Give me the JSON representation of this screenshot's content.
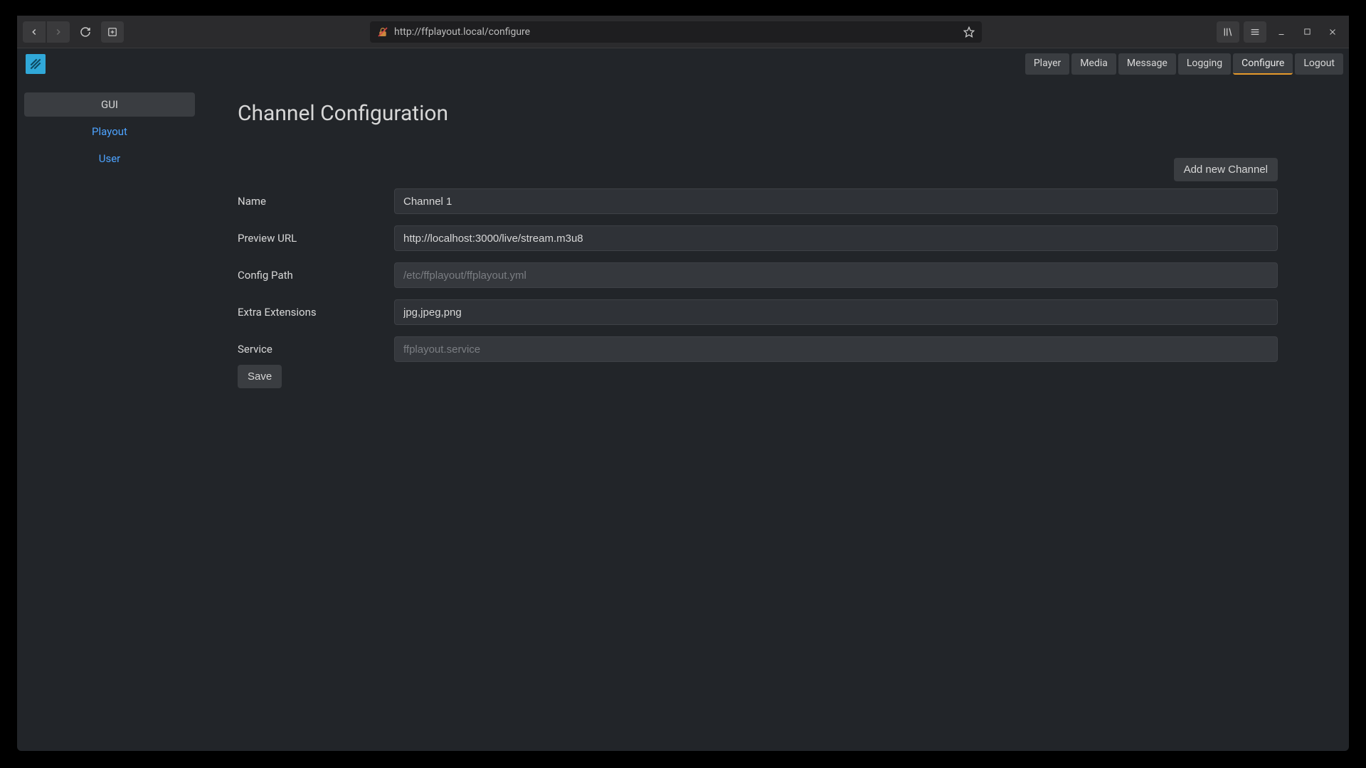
{
  "browser": {
    "url": "http://ffplayout.local/configure"
  },
  "nav": {
    "items": [
      {
        "label": "Player"
      },
      {
        "label": "Media"
      },
      {
        "label": "Message"
      },
      {
        "label": "Logging"
      },
      {
        "label": "Configure",
        "active": true
      },
      {
        "label": "Logout"
      }
    ]
  },
  "sidebar": {
    "items": [
      {
        "label": "GUI",
        "active": true
      },
      {
        "label": "Playout"
      },
      {
        "label": "User"
      }
    ]
  },
  "page": {
    "title": "Channel Configuration",
    "add_channel_label": "Add new Channel",
    "save_label": "Save"
  },
  "form": {
    "fields": [
      {
        "label": "Name",
        "value": "Channel 1",
        "disabled": false
      },
      {
        "label": "Preview URL",
        "value": "http://localhost:3000/live/stream.m3u8",
        "disabled": false
      },
      {
        "label": "Config Path",
        "value": "/etc/ffplayout/ffplayout.yml",
        "disabled": true
      },
      {
        "label": "Extra Extensions",
        "value": "jpg,jpeg,png",
        "disabled": false
      },
      {
        "label": "Service",
        "value": "ffplayout.service",
        "disabled": true
      }
    ]
  }
}
